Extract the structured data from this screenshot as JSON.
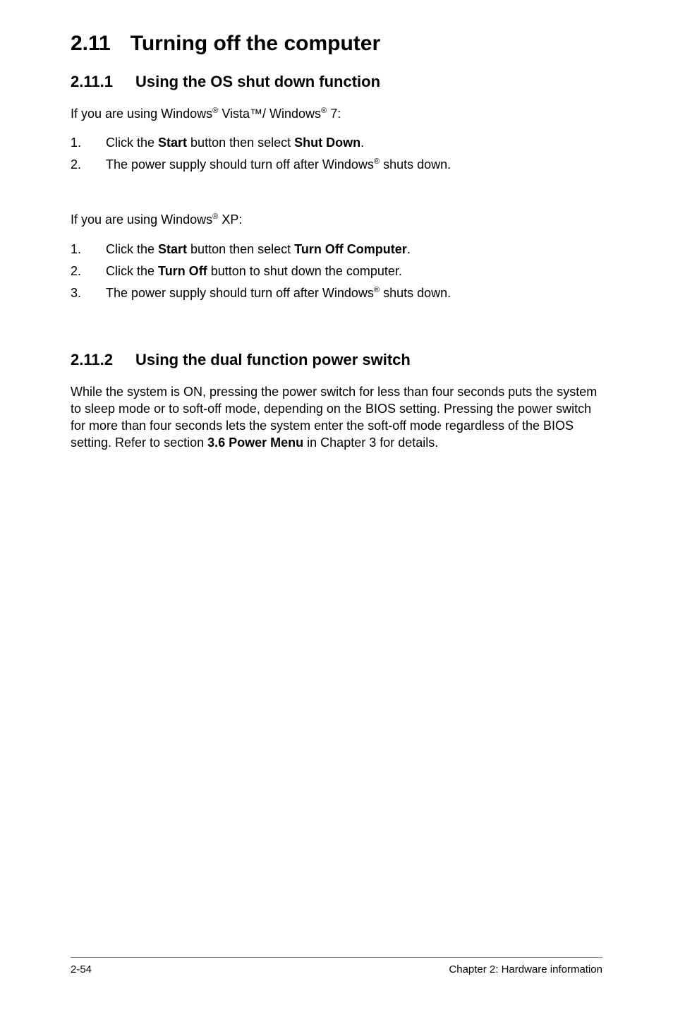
{
  "section": {
    "number": "2.11",
    "title": "Turning off the computer"
  },
  "sub1": {
    "number": "2.11.1",
    "title": "Using the OS shut down function",
    "intro_vista_pre": "If you are using Windows",
    "intro_vista_mid1": " Vista™/ Windows",
    "intro_vista_post": " 7:",
    "vista_steps": [
      {
        "n": "1.",
        "pre": "Click the ",
        "b1": "Start",
        "mid": " button then select ",
        "b2": "Shut Down",
        "post": "."
      },
      {
        "n": "2.",
        "pre": "The power supply should turn off after Windows",
        "sup": "®",
        "post": " shuts down."
      }
    ],
    "intro_xp_pre": "If you are using Windows",
    "intro_xp_post": " XP:",
    "xp_steps": [
      {
        "n": "1.",
        "pre": "Click the ",
        "b1": "Start",
        "mid": " button then select ",
        "b2": "Turn Off Computer",
        "post": "."
      },
      {
        "n": "2.",
        "pre": "Click the ",
        "b1": "Turn Off",
        "post": " button to shut down the computer."
      },
      {
        "n": "3.",
        "pre": "The power supply should turn off after Windows",
        "sup": "®",
        "post": " shuts down."
      }
    ]
  },
  "sub2": {
    "number": "2.11.2",
    "title": "Using the dual function power switch",
    "para_pre": "While the system is ON, pressing the power switch for less than four seconds puts the system to sleep mode or to soft-off mode, depending on the BIOS setting. Pressing the power switch for more than four seconds lets the system enter the soft-off mode regardless of the BIOS setting. Refer to section ",
    "para_bold": "3.6 Power Menu",
    "para_post": " in Chapter 3 for details."
  },
  "footer": {
    "left": "2-54",
    "right": "Chapter 2: Hardware information"
  },
  "reg": "®"
}
